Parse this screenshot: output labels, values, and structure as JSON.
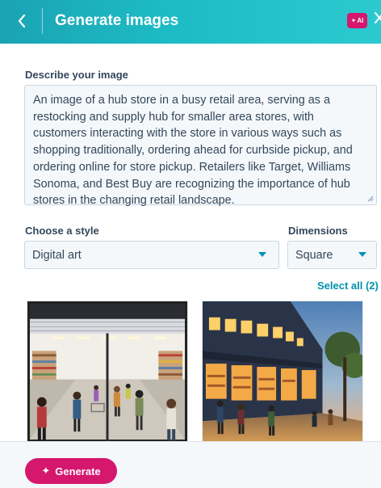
{
  "header": {
    "title": "Generate images",
    "ai_badge": "AI",
    "back_icon": "chevron-left-icon",
    "close_icon": "close-icon"
  },
  "description": {
    "label": "Describe your image",
    "value": "An image of a hub store in a busy retail area, serving as a restocking and supply hub for smaller area stores, with customers interacting with the store in various ways such as shopping traditionally, ordering ahead for curbside pickup, and ordering online for store pickup. Retailers like Target, Williams Sonoma, and Best Buy are recognizing the importance of hub stores in the changing retail landscape."
  },
  "style": {
    "label": "Choose a style",
    "selected": "Digital art"
  },
  "dimensions": {
    "label": "Dimensions",
    "selected": "Square"
  },
  "select_all": "Select all (2)",
  "results": [
    {
      "kind": "store interior daytime digital art"
    },
    {
      "kind": "storefront street at dusk digital art"
    }
  ],
  "footer": {
    "generate_label": "Generate"
  },
  "colors": {
    "header_start": "#1aa3b3",
    "header_end": "#2cc9d0",
    "accent_pink": "#d5176e",
    "link_teal": "#0091ae"
  }
}
